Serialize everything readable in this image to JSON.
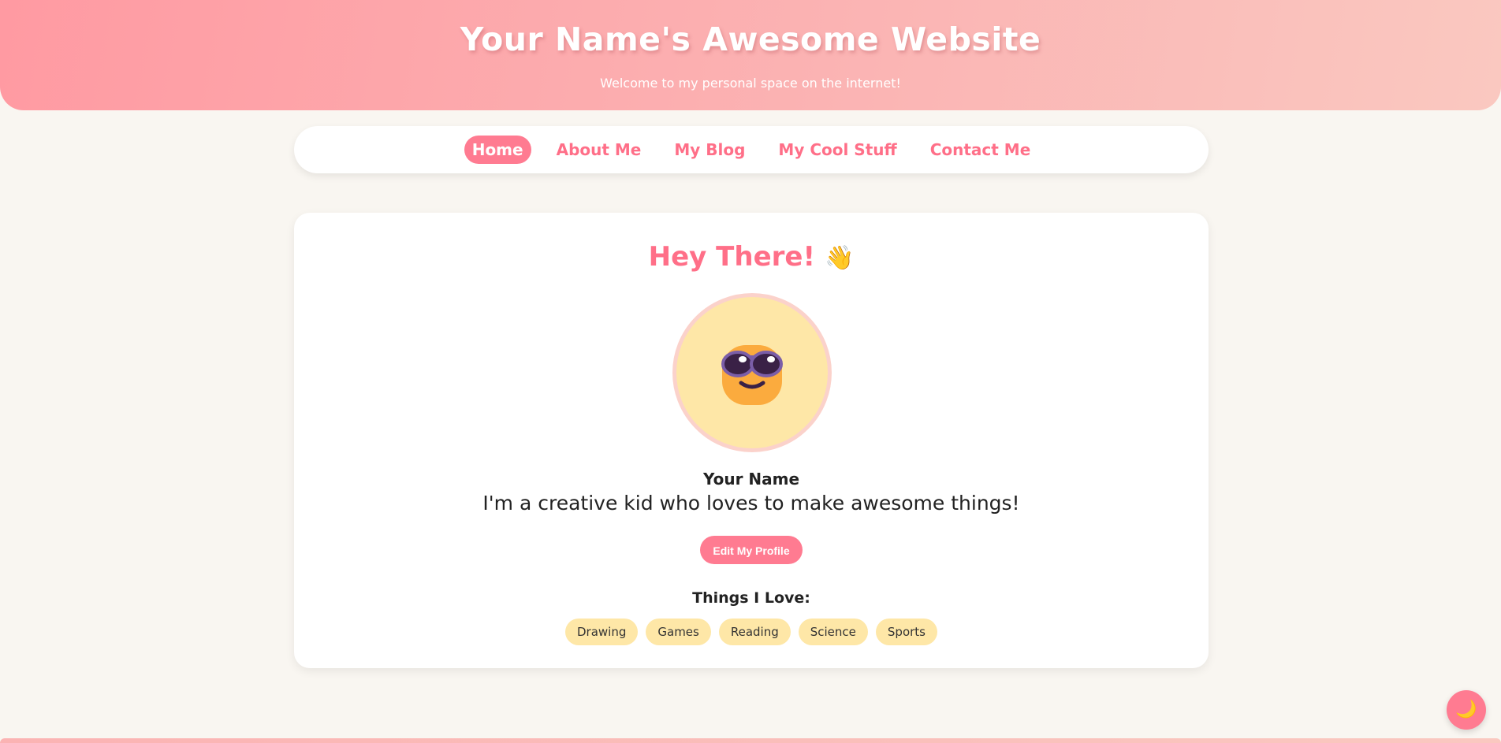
{
  "header": {
    "title": "Your Name's Awesome Website",
    "subtitle": "Welcome to my personal space on the internet!"
  },
  "nav": {
    "items": [
      {
        "label": "Home",
        "active": true
      },
      {
        "label": "About Me",
        "active": false
      },
      {
        "label": "My Blog",
        "active": false
      },
      {
        "label": "My Cool Stuff",
        "active": false
      },
      {
        "label": "Contact Me",
        "active": false
      }
    ]
  },
  "profile": {
    "greeting": "Hey There!",
    "greeting_icon": "👋",
    "avatar_icon": "sunglasses-smiley-icon",
    "name": "Your Name",
    "bio": "I'm a creative kid who loves to make awesome things!",
    "edit_label": "Edit My Profile",
    "loves_heading": "Things I Love:",
    "loves": [
      "Drawing",
      "Games",
      "Reading",
      "Science",
      "Sports"
    ]
  },
  "theme_toggle": {
    "icon": "🌙",
    "icon_name": "moon-icon"
  },
  "colors": {
    "accent": "#ff7b91",
    "accent_text": "#ff6f88",
    "tag_bg": "#fee7a7",
    "page_bg": "#f9f6f1"
  }
}
